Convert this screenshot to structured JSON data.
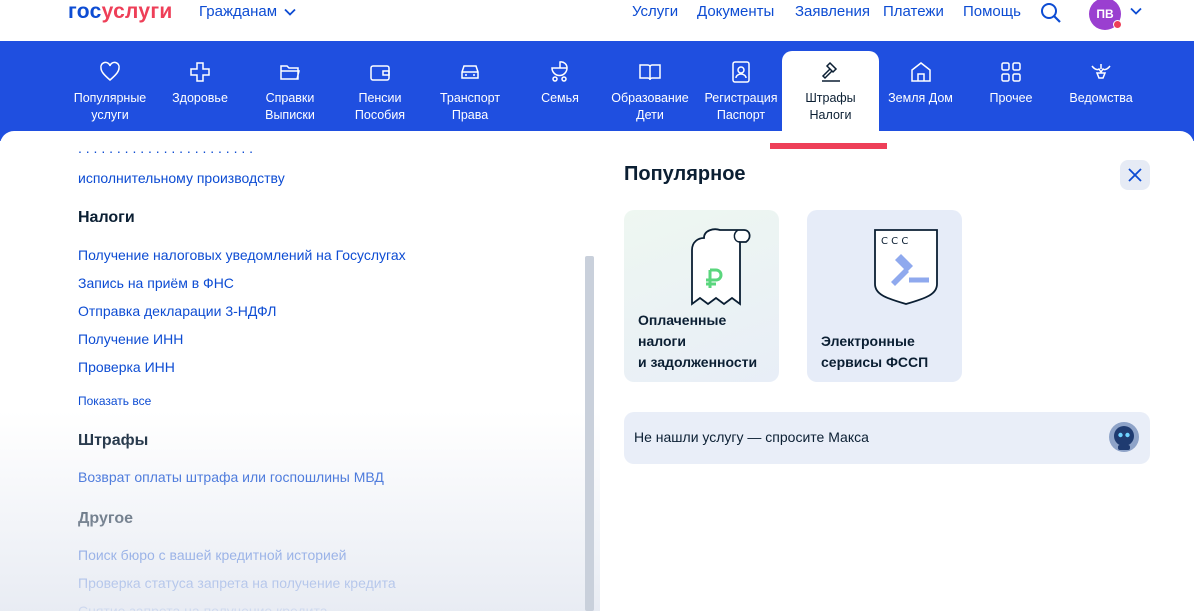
{
  "header": {
    "logo_part1": "гос",
    "logo_part2": "услуги",
    "audience_label": "Гражданам",
    "nav": [
      "Услуги",
      "Документы",
      "Заявления",
      "Платежи",
      "Помощь"
    ],
    "avatar_initials": "ПВ",
    "icons": [
      "search-icon",
      "chevron-down-icon"
    ]
  },
  "categories": [
    {
      "line1": "Популярные",
      "line2": "услуги",
      "icon": "heart-icon"
    },
    {
      "line1": "Здоровье",
      "line2": "",
      "icon": "plus-icon"
    },
    {
      "line1": "Справки",
      "line2": "Выписки",
      "icon": "folder-icon"
    },
    {
      "line1": "Пенсии",
      "line2": "Пособия",
      "icon": "wallet-icon"
    },
    {
      "line1": "Транспорт",
      "line2": "Права",
      "icon": "car-icon"
    },
    {
      "line1": "Семья",
      "line2": "",
      "icon": "stroller-icon"
    },
    {
      "line1": "Образование",
      "line2": "Дети",
      "icon": "book-icon"
    },
    {
      "line1": "Регистрация",
      "line2": "Паспорт",
      "icon": "passport-icon"
    },
    {
      "line1": "Штрафы",
      "line2": "Налоги",
      "icon": "gavel-icon",
      "active": true
    },
    {
      "line1": "Земля Дом",
      "line2": "",
      "icon": "house-icon"
    },
    {
      "line1": "Прочее",
      "line2": "",
      "icon": "grid-icon"
    },
    {
      "line1": "Ведомства",
      "line2": "",
      "icon": "eagle-icon"
    }
  ],
  "left": {
    "cut_link": "исполнительному производству",
    "sections": [
      {
        "title": "Налоги",
        "links": [
          "Получение налоговых уведомлений на Госуслугах",
          "Запись на приём в ФНС",
          "Отправка декларации 3-НДФЛ",
          "Получение ИНН",
          "Проверка ИНН"
        ],
        "show_all": "Показать все"
      },
      {
        "title": "Штрафы",
        "links": [
          "Возврат оплаты штрафа или госпошлины МВД"
        ]
      },
      {
        "title": "Другое",
        "links": [
          "Поиск бюро с вашей кредитной историей",
          "Проверка статуса запрета на получение кредита",
          "Снятие запрета на получение кредита"
        ]
      }
    ]
  },
  "right": {
    "title": "Популярное",
    "cards": [
      {
        "lines": [
          "Оплаченные",
          "налоги",
          "и задолженности"
        ]
      },
      {
        "lines": [
          "Электронные",
          "сервисы ФССП"
        ]
      }
    ],
    "ask": "Не нашли услугу — спросите Макса"
  },
  "colors": {
    "brand_blue": "#0d4cd3",
    "brand_red": "#ee3f58",
    "bar_blue": "#1f4fe0"
  }
}
